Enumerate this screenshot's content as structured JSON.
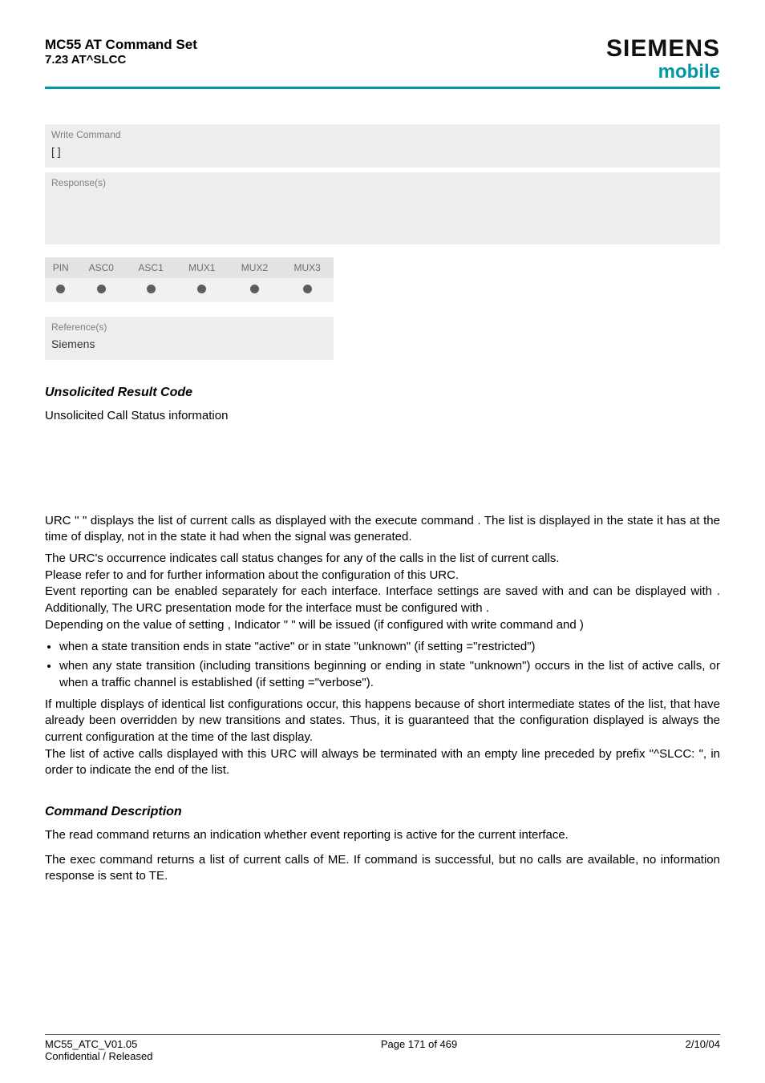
{
  "header": {
    "title_line1": "MC55 AT Command Set",
    "title_line2": "7.23 AT^SLCC",
    "brand": "SIEMENS",
    "subbrand": "Mobile"
  },
  "write_cmd": {
    "label": "Write Command",
    "body": "[   ]"
  },
  "response": {
    "label": "Response(s)"
  },
  "matrix": {
    "cols": [
      "PIN",
      "ASC0",
      "ASC1",
      "MUX1",
      "MUX2",
      "MUX3"
    ],
    "dot_color": "#5c5d5e"
  },
  "reference": {
    "label": "Reference(s)",
    "value": "Siemens"
  },
  "urc": {
    "heading": "Unsolicited Result Code",
    "line1": "Unsolicited Call Status information"
  },
  "body": {
    "p1a": "URC \"",
    "p1b": "\" displays the list of current calls as displayed with the execute command ",
    "p1c": ". The list is displayed in the state it has at the time of display, not in the state it had when the signal was generated.",
    "p2": "The URC's occurrence indicates call status changes for any of the calls in the list of current calls.",
    "p3a": "Please refer to ",
    "p3b": " and ",
    "p3c": " for further information about the configuration of this URC.",
    "p4a": "Event reporting can be enabled separately for each interface. Interface settings are saved with ",
    "p4b": " and can be displayed with ",
    "p4c": ". Additionally, The URC presentation mode for the interface must be configured with ",
    "p4d": ".",
    "p5a": "Depending on the value of ",
    "p5b": " setting ",
    "p5c": ", Indicator \"",
    "p5d": "\" will be issued (if configured with write command ",
    "p5e": " and ",
    "p5f": ")",
    "b1a": "when a state transition ends in state \"active\" or in state \"unknown\" (if ",
    "b1b": " setting ",
    "b1c": "=\"restricted\")",
    "b2a": "when any state transition (including transitions beginning or ending in state \"unknown\") occurs in the list of active calls, or when a traffic channel is established (if ",
    "b2b": " setting ",
    "b2c": "=\"verbose\").",
    "p6": "If multiple displays of identical list configurations occur, this happens because of short intermediate states of the list, that have already been overridden by new transitions and states. Thus, it is guaranteed that the configuration displayed is always the current configuration at the time of the last display.",
    "p7": "The list of active calls displayed with this URC will always be terminated with an empty line preceded by prefix \"^SLCC: \", in order to indicate the end of the list."
  },
  "cmddesc": {
    "heading": "Command Description",
    "p1": "The read command returns an indication whether event reporting is active for the current interface.",
    "p2": "The exec command returns a list of current calls of ME. If command is successful, but no calls are available, no information response is sent to TE."
  },
  "footer": {
    "left1": "MC55_ATC_V01.05",
    "left2": "Confidential / Released",
    "center": "Page 171 of 469",
    "right": "2/10/04"
  }
}
